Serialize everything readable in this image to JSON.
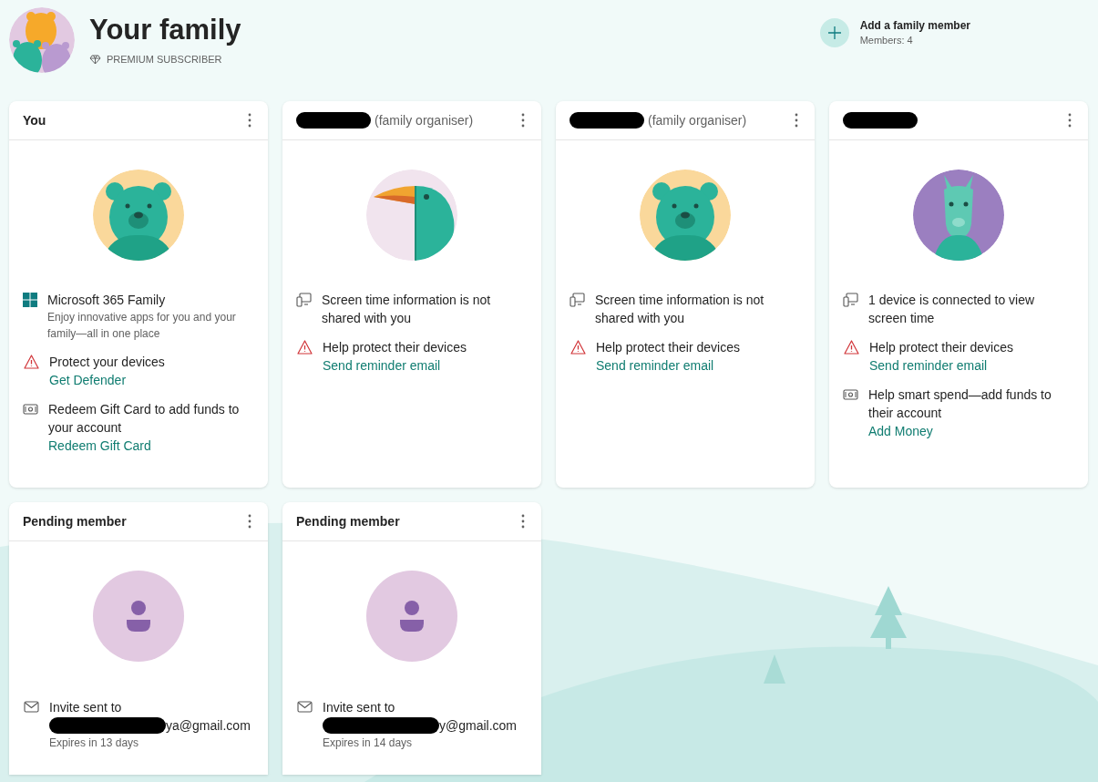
{
  "header": {
    "title": "Your family",
    "badge": "PREMIUM SUBSCRIBER",
    "add_member": {
      "label": "Add a family member",
      "count": "Members: 4"
    }
  },
  "members": [
    {
      "title": "You",
      "avatar": {
        "kind": "bear"
      },
      "items": [
        {
          "kind": "product",
          "text": "Microsoft 365 Family",
          "subtext": "Enjoy innovative apps for you and your family—all in one place"
        },
        {
          "kind": "warning",
          "text": "Protect your devices",
          "link": "Get Defender"
        },
        {
          "kind": "money",
          "text": "Redeem Gift Card to add funds to your account",
          "link": "Redeem Gift Card"
        }
      ]
    },
    {
      "redacted": true,
      "role": "(family organiser)",
      "avatar": {
        "kind": "toucan"
      },
      "items": [
        {
          "kind": "screen",
          "text": "Screen time information is not shared with you"
        },
        {
          "kind": "warning",
          "text": "Help protect their devices",
          "link": "Send reminder email"
        }
      ]
    },
    {
      "redacted": true,
      "role": "(family organiser)",
      "avatar": {
        "kind": "bear"
      },
      "items": [
        {
          "kind": "screen",
          "text": "Screen time information is not shared with you"
        },
        {
          "kind": "warning",
          "text": "Help protect their devices",
          "link": "Send reminder email"
        }
      ]
    },
    {
      "redacted": true,
      "avatar": {
        "kind": "llama"
      },
      "items": [
        {
          "kind": "screen",
          "text": "1 device is connected to view screen time"
        },
        {
          "kind": "warning",
          "text": "Help protect their devices",
          "link": "Send reminder email"
        },
        {
          "kind": "money",
          "text": "Help smart spend—add funds to their account",
          "link": "Add Money"
        }
      ]
    },
    {
      "title": "Pending member",
      "avatar": {
        "kind": "pending"
      },
      "items": [
        {
          "kind": "mail",
          "text": "Invite sent to",
          "email": "ya@gmail.com",
          "email_redacted": true,
          "subtext": "Expires in 13 days"
        }
      ]
    },
    {
      "title": "Pending member",
      "avatar": {
        "kind": "pending"
      },
      "items": [
        {
          "kind": "mail",
          "text": "Invite sent to",
          "email": "y@gmail.com",
          "email_redacted": true,
          "subtext": "Expires in 14 days"
        }
      ]
    }
  ]
}
